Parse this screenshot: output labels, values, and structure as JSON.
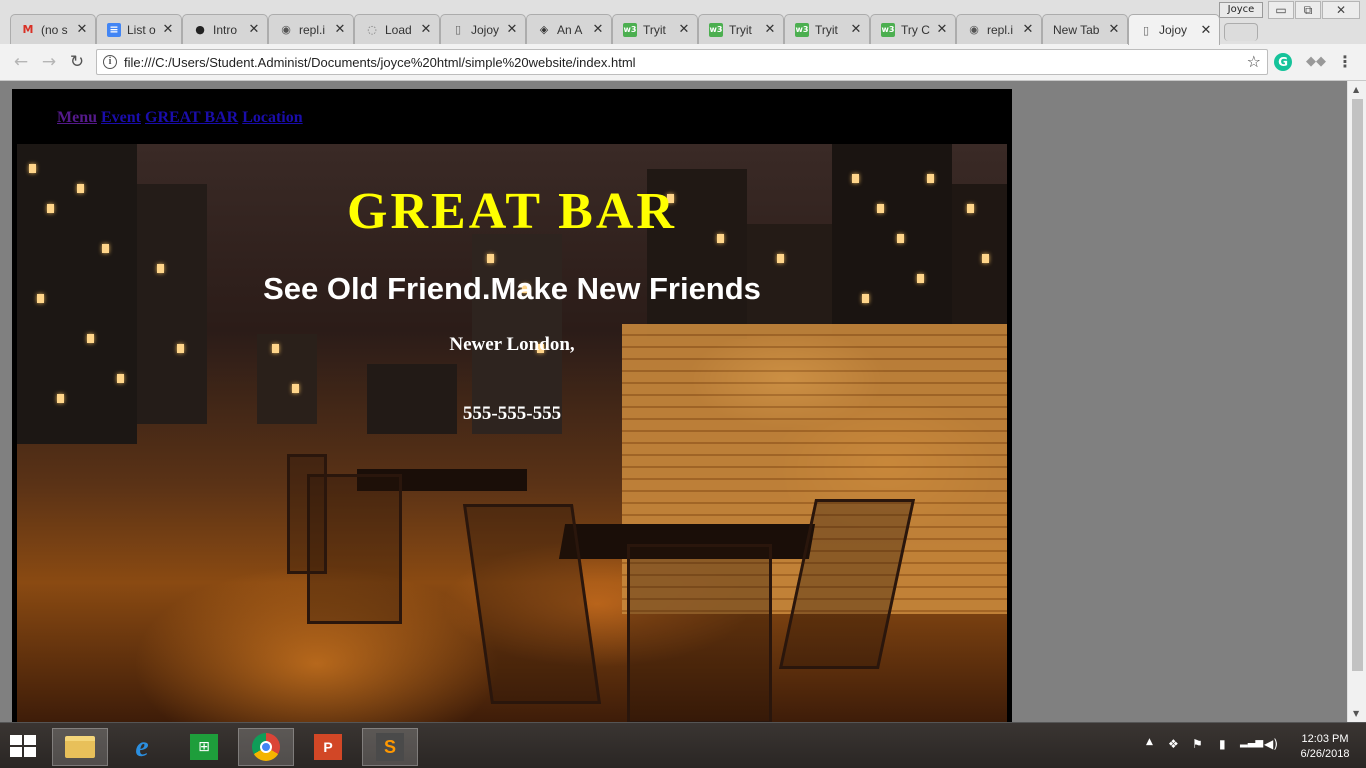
{
  "window": {
    "profile_name": "Joyce",
    "controls": {
      "minimize": "▭",
      "restore": "⧉",
      "close": "✕"
    }
  },
  "tabs": [
    {
      "label": "(no s",
      "icon": "gmail-icon",
      "icon_glyph": "M",
      "icon_color": "#d93025"
    },
    {
      "label": "List o",
      "icon": "docs-icon",
      "icon_glyph": "≡",
      "icon_color": "#4285f4"
    },
    {
      "label": "Intro",
      "icon": "github-icon",
      "icon_glyph": "●",
      "icon_color": "#222222"
    },
    {
      "label": "repl.i",
      "icon": "repl-icon",
      "icon_glyph": "◉",
      "icon_color": "#555555"
    },
    {
      "label": "Load",
      "icon": "loading-icon",
      "icon_glyph": "◌",
      "icon_color": "#777777"
    },
    {
      "label": "Jojoy",
      "icon": "page-icon",
      "icon_glyph": "▯",
      "icon_color": "#666666"
    },
    {
      "label": "An A",
      "icon": "codepen-icon",
      "icon_glyph": "◈",
      "icon_color": "#333333"
    },
    {
      "label": "Tryit",
      "icon": "w3schools-icon",
      "icon_glyph": "w3",
      "icon_color": "#4caf50"
    },
    {
      "label": "Tryit",
      "icon": "w3schools-icon",
      "icon_glyph": "w3",
      "icon_color": "#4caf50"
    },
    {
      "label": "Tryit",
      "icon": "w3schools-icon",
      "icon_glyph": "w3",
      "icon_color": "#4caf50"
    },
    {
      "label": "Try C",
      "icon": "w3schools-icon",
      "icon_glyph": "w3",
      "icon_color": "#4caf50"
    },
    {
      "label": "repl.i",
      "icon": "repl-icon",
      "icon_glyph": "◉",
      "icon_color": "#555555"
    },
    {
      "label": "New Tab",
      "icon": "",
      "icon_glyph": "",
      "icon_color": "#666666"
    },
    {
      "label": "Jojoy",
      "icon": "page-icon",
      "icon_glyph": "▯",
      "icon_color": "#666666",
      "active": true
    }
  ],
  "toolbar": {
    "back": "←",
    "forward": "→",
    "reload": "↻",
    "info": "i",
    "url": "file:///C:/Users/Student.Administ/Documents/joyce%20html/simple%20website/index.html",
    "bookmark_star": "☆",
    "grammarly": "G",
    "dropbox": "◆◆",
    "menu": "⋮"
  },
  "site": {
    "nav": [
      "Menu",
      "Event",
      "GREAT BAR",
      "Location"
    ],
    "title": "GREAT BAR",
    "tagline": "See Old Friend.Make New Friends",
    "city": "Newer London,",
    "phone": "555-555-555"
  },
  "taskbar": {
    "apps": [
      {
        "name": "file-explorer-icon",
        "glyph": "📁"
      },
      {
        "name": "internet-explorer-icon",
        "glyph": "e"
      },
      {
        "name": "store-icon",
        "glyph": "⊞"
      },
      {
        "name": "chrome-icon",
        "glyph": "◎"
      },
      {
        "name": "powerpoint-icon",
        "glyph": "P"
      },
      {
        "name": "sublime-text-icon",
        "glyph": "S"
      }
    ],
    "time": "12:03 PM",
    "date": "6/26/2018"
  }
}
